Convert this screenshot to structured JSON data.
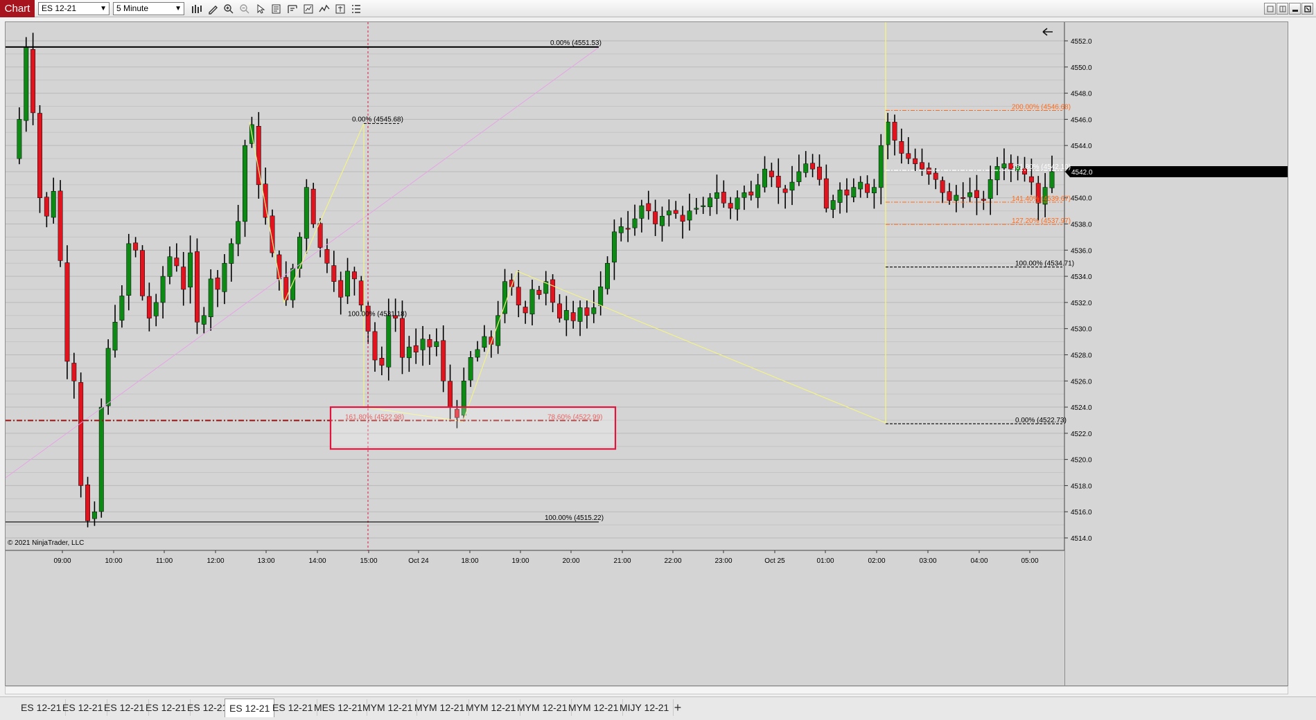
{
  "toolbar": {
    "chart_label": "Chart",
    "instrument": "ES 12-21",
    "interval": "5 Minute",
    "tools": [
      "bar-type-icon",
      "drawing-tool-icon",
      "zoom-in-icon",
      "zoom-out-icon",
      "pointer-icon",
      "data-box-icon",
      "properties-icon",
      "strategies-icon",
      "indicators-icon",
      "chart-trader-icon",
      "more-icon"
    ]
  },
  "window_buttons": [
    "restore-icon",
    "tile-icon",
    "minimize-icon",
    "close-icon"
  ],
  "copyright": "© 2021 NinjaTrader, LLC",
  "tabs": [
    "ES 12-21",
    "ES 12-21",
    "ES 12-21",
    "ES 12-21",
    "ES 12-21",
    "ES 12-21",
    "ES 12-21",
    "MES 12-21",
    "MYM 12-21",
    "MYM 12-21",
    "MYM 12-21",
    "MYM 12-21",
    "MYM 12-21",
    "MIJY 12-21"
  ],
  "active_tab_index": 5,
  "add_tab_label": "+",
  "colors": {
    "background": "#d4d4d4",
    "up_candle": "#0c8a14",
    "down_candle": "#e0141e",
    "fib_orange": "#ff6a1a",
    "highlight_box": "#e0143c",
    "zigzag": "#f2f28a"
  },
  "chart_data": {
    "type": "candlestick",
    "instrument": "ES 12-21",
    "interval": "5 Minute",
    "y_ticks": [
      "4552.0",
      "4550.0",
      "4548.0",
      "4546.0",
      "4544.0",
      "4542.0",
      "4540.0",
      "4538.0",
      "4536.0",
      "4534.0",
      "4532.0",
      "4530.0",
      "4528.0",
      "4526.0",
      "4524.0",
      "4522.0",
      "4520.0",
      "4518.0",
      "4516.0",
      "4514.0"
    ],
    "ylim": [
      4513.2,
      4553.4
    ],
    "x_ticks": [
      "09:00",
      "10:00",
      "11:00",
      "12:00",
      "13:00",
      "14:00",
      "15:00",
      "Oct 24",
      "18:00",
      "19:00",
      "20:00",
      "21:00",
      "22:00",
      "23:00",
      "Oct 25",
      "01:00",
      "02:00",
      "03:00",
      "04:00",
      "05:00"
    ],
    "last_price": "4542.0",
    "fib_labels": {
      "top_0": "0.00% (4551.53)",
      "bottom_100": "100.00% (4515.22)",
      "retr_0": "0.00% (4545.68)",
      "retr_mid": "100.00% (4531.18)",
      "ext_161": "161.80% (4522.98)",
      "ext_786": "78.60% (4522.99)",
      "ext_200": "200.00% (4546.68)",
      "ext_161b": "161.80% (4542.10)",
      "ext_141": "141.40% (4539.67)",
      "ext_127": "127.20% (4537.97)",
      "ext_100": "100.00% (4534.71)",
      "ext_0": "0.00% (4522.73)"
    },
    "path": [
      [
        0,
        4543.0
      ],
      [
        1,
        4546.0
      ],
      [
        2,
        4551.5
      ],
      [
        3,
        4546.5
      ],
      [
        4,
        4540.0
      ],
      [
        5,
        4538.6
      ],
      [
        6,
        4540.5
      ],
      [
        7,
        4535.2
      ],
      [
        8,
        4527.5
      ],
      [
        9,
        4526.0
      ],
      [
        10,
        4518.0
      ],
      [
        11,
        4515.3
      ],
      [
        12,
        4516.0
      ],
      [
        13,
        4524.0
      ],
      [
        14,
        4528.5
      ],
      [
        15,
        4530.5
      ],
      [
        16,
        4532.5
      ],
      [
        17,
        4536.5
      ],
      [
        18,
        4536.0
      ],
      [
        19,
        4532.5
      ],
      [
        20,
        4530.8
      ],
      [
        21,
        4532.0
      ],
      [
        22,
        4534.0
      ],
      [
        23,
        4535.5
      ],
      [
        24,
        4534.8
      ],
      [
        25,
        4533.0
      ],
      [
        26,
        4535.8
      ],
      [
        27,
        4530.5
      ],
      [
        28,
        4531.0
      ],
      [
        29,
        4533.8
      ],
      [
        30,
        4533.0
      ],
      [
        31,
        4535.0
      ],
      [
        32,
        4536.5
      ],
      [
        33,
        4538.2
      ],
      [
        34,
        4544.0
      ],
      [
        35,
        4545.6
      ],
      [
        36,
        4541.0
      ],
      [
        37,
        4538.5
      ],
      [
        38,
        4535.8
      ],
      [
        39,
        4533.8
      ],
      [
        40,
        4532.2
      ],
      [
        41,
        4534.6
      ],
      [
        42,
        4537.0
      ],
      [
        43,
        4540.8
      ],
      [
        44,
        4538.0
      ],
      [
        45,
        4536.2
      ],
      [
        46,
        4535.0
      ],
      [
        47,
        4533.6
      ],
      [
        48,
        4532.4
      ],
      [
        49,
        4534.4
      ],
      [
        50,
        4533.8
      ],
      [
        51,
        4531.8
      ],
      [
        52,
        4529.8
      ],
      [
        53,
        4527.6
      ],
      [
        54,
        4527.2
      ],
      [
        55,
        4531.0
      ],
      [
        56,
        4530.8
      ],
      [
        57,
        4527.8
      ],
      [
        58,
        4528.6
      ],
      [
        59,
        4528.2
      ],
      [
        60,
        4529.2
      ],
      [
        61,
        4528.6
      ],
      [
        62,
        4529.0
      ],
      [
        63,
        4526.0
      ],
      [
        64,
        4524.0
      ],
      [
        65,
        4523.2
      ],
      [
        66,
        4526.0
      ],
      [
        67,
        4527.8
      ],
      [
        68,
        4528.4
      ],
      [
        69,
        4529.4
      ],
      [
        70,
        4528.8
      ],
      [
        71,
        4531.0
      ],
      [
        72,
        4533.6
      ],
      [
        73,
        4533.2
      ],
      [
        74,
        4531.8
      ],
      [
        75,
        4531.2
      ],
      [
        76,
        4533.0
      ],
      [
        77,
        4532.6
      ],
      [
        78,
        4533.6
      ],
      [
        79,
        4532.0
      ],
      [
        80,
        4530.8
      ],
      [
        81,
        4531.4
      ],
      [
        82,
        4530.6
      ],
      [
        83,
        4531.6
      ],
      [
        84,
        4531.0
      ],
      [
        85,
        4531.6
      ],
      [
        86,
        4533.2
      ],
      [
        87,
        4535.0
      ],
      [
        88,
        4537.4
      ],
      [
        89,
        4537.8
      ],
      [
        90,
        4537.6
      ],
      [
        91,
        4538.4
      ],
      [
        92,
        4539.4
      ],
      [
        93,
        4539.0
      ],
      [
        94,
        4538.0
      ],
      [
        95,
        4538.6
      ],
      [
        96,
        4539.0
      ],
      [
        97,
        4538.8
      ],
      [
        98,
        4538.2
      ],
      [
        99,
        4539.0
      ],
      [
        100,
        4539.2
      ],
      [
        101,
        4539.4
      ],
      [
        102,
        4540.0
      ],
      [
        103,
        4540.4
      ],
      [
        104,
        4539.6
      ],
      [
        105,
        4539.2
      ],
      [
        106,
        4540.0
      ],
      [
        107,
        4540.4
      ],
      [
        108,
        4540.2
      ],
      [
        109,
        4541.0
      ],
      [
        110,
        4542.2
      ],
      [
        111,
        4541.6
      ],
      [
        112,
        4540.8
      ],
      [
        113,
        4540.4
      ],
      [
        114,
        4541.2
      ],
      [
        115,
        4542.0
      ],
      [
        116,
        4542.6
      ],
      [
        117,
        4542.2
      ],
      [
        118,
        4541.4
      ],
      [
        119,
        4539.2
      ],
      [
        120,
        4539.8
      ],
      [
        121,
        4540.6
      ],
      [
        122,
        4540.2
      ],
      [
        123,
        4540.8
      ],
      [
        124,
        4541.2
      ],
      [
        125,
        4540.4
      ],
      [
        126,
        4540.8
      ],
      [
        127,
        4544.0
      ],
      [
        128,
        4545.8
      ],
      [
        129,
        4544.4
      ],
      [
        130,
        4543.4
      ],
      [
        131,
        4543.0
      ],
      [
        132,
        4542.6
      ],
      [
        133,
        4542.2
      ],
      [
        134,
        4541.8
      ],
      [
        135,
        4541.4
      ],
      [
        136,
        4540.4
      ],
      [
        137,
        4539.8
      ],
      [
        138,
        4540.2
      ],
      [
        139,
        4540.0
      ],
      [
        140,
        4540.4
      ],
      [
        141,
        4540.0
      ],
      [
        142,
        4539.8
      ],
      [
        143,
        4541.4
      ],
      [
        144,
        4542.4
      ],
      [
        145,
        4542.6
      ],
      [
        146,
        4542.2
      ],
      [
        147,
        4542.4
      ],
      [
        148,
        4541.8
      ],
      [
        149,
        4541.2
      ],
      [
        150,
        4539.6
      ],
      [
        151,
        4540.8
      ],
      [
        152,
        4542.0
      ]
    ],
    "bar_count": 153
  }
}
